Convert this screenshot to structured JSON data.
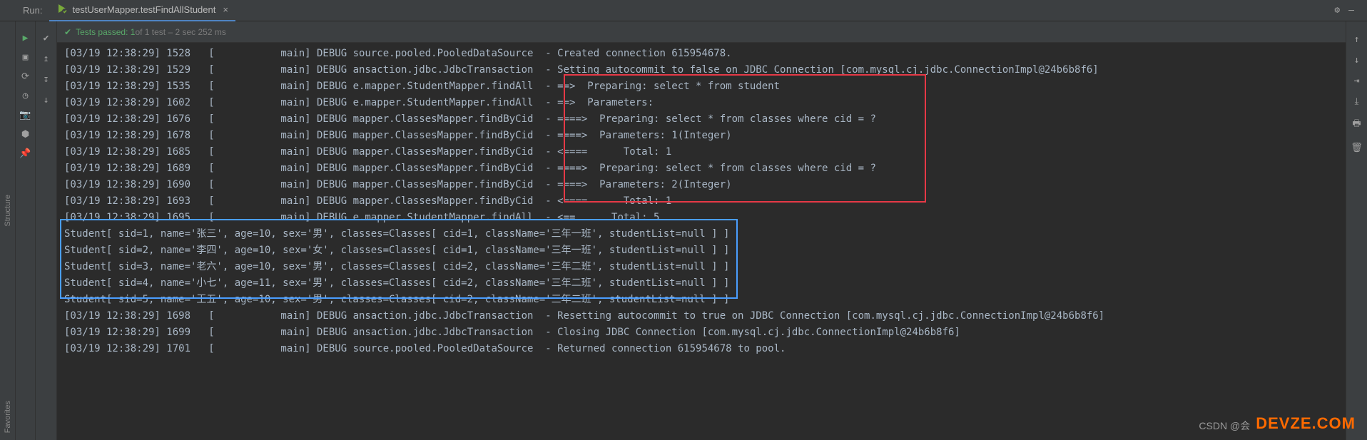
{
  "topbar": {
    "run_label": "Run:",
    "tab_label": "testUserMapper.testFindAllStudent",
    "tab_close": "×",
    "gear": "⚙",
    "minimize": "—"
  },
  "status": {
    "check": "✔",
    "tests_passed": "Tests passed: 1",
    "of_tests": " of 1 test – 2 sec 252 ms"
  },
  "console_lines": [
    "[03/19 12:38:29] 1528   [           main] DEBUG source.pooled.PooledDataSource  - Created connection 615954678.",
    "[03/19 12:38:29] 1529   [           main] DEBUG ansaction.jdbc.JdbcTransaction  - Setting autocommit to false on JDBC Connection [com.mysql.cj.jdbc.ConnectionImpl@24b6b8f6]",
    "[03/19 12:38:29] 1535   [           main] DEBUG e.mapper.StudentMapper.findAll  - ==>  Preparing: select * from student",
    "[03/19 12:38:29] 1602   [           main] DEBUG e.mapper.StudentMapper.findAll  - ==>  Parameters:",
    "[03/19 12:38:29] 1676   [           main] DEBUG mapper.ClassesMapper.findByCid  - ====>  Preparing: select * from classes where cid = ?",
    "[03/19 12:38:29] 1678   [           main] DEBUG mapper.ClassesMapper.findByCid  - ====>  Parameters: 1(Integer)",
    "[03/19 12:38:29] 1685   [           main] DEBUG mapper.ClassesMapper.findByCid  - <====      Total: 1",
    "[03/19 12:38:29] 1689   [           main] DEBUG mapper.ClassesMapper.findByCid  - ====>  Preparing: select * from classes where cid = ?",
    "[03/19 12:38:29] 1690   [           main] DEBUG mapper.ClassesMapper.findByCid  - ====>  Parameters: 2(Integer)",
    "[03/19 12:38:29] 1693   [           main] DEBUG mapper.ClassesMapper.findByCid  - <====      Total: 1",
    "[03/19 12:38:29] 1695   [           main] DEBUG e.mapper.StudentMapper.findAll  - <==      Total: 5",
    "Student[ sid=1, name='张三', age=10, sex='男', classes=Classes[ cid=1, className='三年一班', studentList=null ] ]",
    "Student[ sid=2, name='李四', age=10, sex='女', classes=Classes[ cid=1, className='三年一班', studentList=null ] ]",
    "Student[ sid=3, name='老六', age=10, sex='男', classes=Classes[ cid=2, className='三年二班', studentList=null ] ]",
    "Student[ sid=4, name='小七', age=11, sex='男', classes=Classes[ cid=2, className='三年二班', studentList=null ] ]",
    "Student[ sid=5, name='王五', age=10, sex='男', classes=Classes[ cid=2, className='三年二班', studentList=null ] ]",
    "[03/19 12:38:29] 1698   [           main] DEBUG ansaction.jdbc.JdbcTransaction  - Resetting autocommit to true on JDBC Connection [com.mysql.cj.jdbc.ConnectionImpl@24b6b8f6]",
    "[03/19 12:38:29] 1699   [           main] DEBUG ansaction.jdbc.JdbcTransaction  - Closing JDBC Connection [com.mysql.cj.jdbc.ConnectionImpl@24b6b8f6]",
    "[03/19 12:38:29] 1701   [           main] DEBUG source.pooled.PooledDataSource  - Returned connection 615954678 to pool."
  ],
  "sidebar": {
    "structure": "Structure",
    "favorites": "Favorites"
  },
  "watermark": {
    "csdn": "CSDN @会",
    "devz": "DEVZE.COM"
  }
}
